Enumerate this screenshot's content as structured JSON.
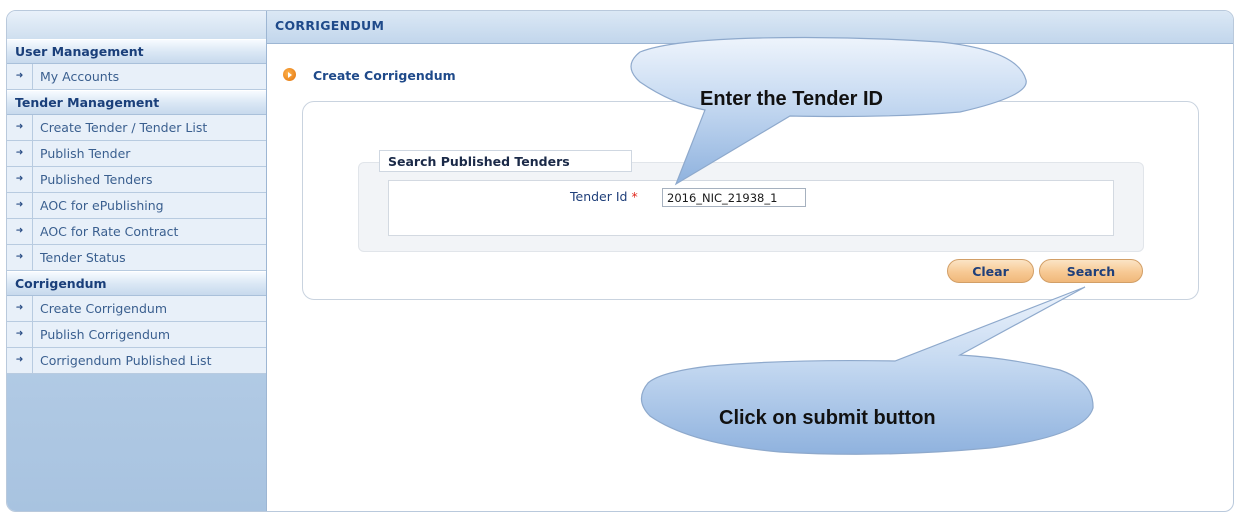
{
  "sidebar": {
    "sections": [
      {
        "title": "User Management",
        "items": [
          "My Accounts"
        ]
      },
      {
        "title": "Tender Management",
        "items": [
          "Create Tender / Tender List",
          "Publish Tender",
          "Published Tenders",
          "AOC for ePublishing",
          "AOC for Rate Contract",
          "Tender Status"
        ]
      },
      {
        "title": "Corrigendum",
        "items": [
          "Create Corrigendum",
          "Publish Corrigendum",
          "Corrigendum Published List"
        ]
      }
    ]
  },
  "header": {
    "title": "CORRIGENDUM"
  },
  "main": {
    "subtitle": "Create Corrigendum",
    "fieldset_legend": "Search Published Tenders",
    "tender_id_label": "Tender Id",
    "required_mark": "*",
    "tender_id_value": "2016_NIC_21938_1",
    "clear_label": "Clear",
    "search_label": "Search"
  },
  "callouts": {
    "top": "Enter the Tender ID",
    "bottom": "Click on submit button"
  },
  "colors": {
    "accent": "#1f4a8a",
    "button": "#f7c994",
    "callout": "#9fbfe6"
  }
}
